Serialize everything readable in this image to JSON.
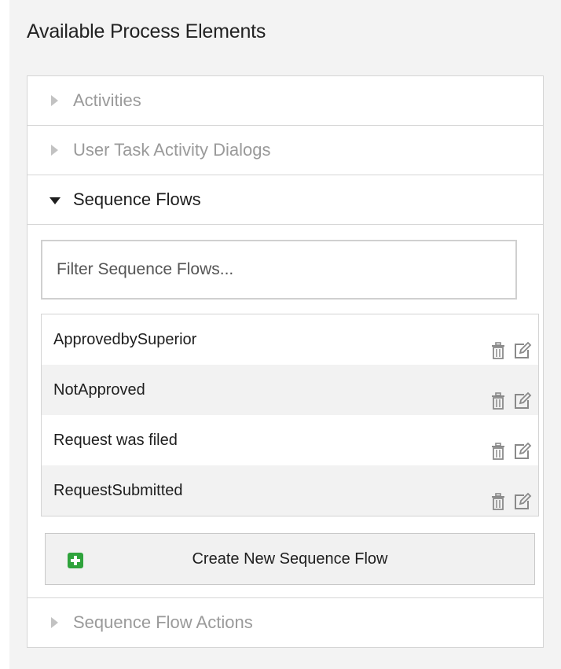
{
  "widget": {
    "title": "Available Process Elements"
  },
  "accordion": {
    "activities_label": "Activities",
    "dialogs_label": "User Task Activity Dialogs",
    "sequence_flows_label": "Sequence Flows",
    "sequence_flow_actions_label": "Sequence Flow Actions"
  },
  "sequence_flows": {
    "filter_placeholder": "Filter Sequence Flows...",
    "items": [
      {
        "name": "ApprovedbySuperior"
      },
      {
        "name": "NotApproved"
      },
      {
        "name": "Request was filed"
      },
      {
        "name": "RequestSubmitted"
      }
    ],
    "row_icons": [
      "trash-icon",
      "edit-icon"
    ],
    "create_button_label": "Create New Sequence Flow",
    "create_icon": "plus-square-icon"
  },
  "colors": {
    "header_bg": "#f3f3f3",
    "collapsed_text": "#9a9a9a",
    "plus_green": "#2fa33c"
  }
}
